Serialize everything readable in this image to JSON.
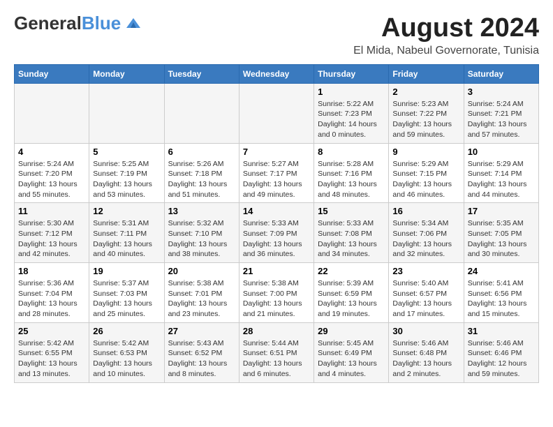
{
  "header": {
    "logo_line1": "General",
    "logo_line2": "Blue",
    "month_year": "August 2024",
    "location": "El Mida, Nabeul Governorate, Tunisia"
  },
  "weekdays": [
    "Sunday",
    "Monday",
    "Tuesday",
    "Wednesday",
    "Thursday",
    "Friday",
    "Saturday"
  ],
  "weeks": [
    [
      {
        "day": "",
        "info": ""
      },
      {
        "day": "",
        "info": ""
      },
      {
        "day": "",
        "info": ""
      },
      {
        "day": "",
        "info": ""
      },
      {
        "day": "1",
        "info": "Sunrise: 5:22 AM\nSunset: 7:23 PM\nDaylight: 14 hours\nand 0 minutes."
      },
      {
        "day": "2",
        "info": "Sunrise: 5:23 AM\nSunset: 7:22 PM\nDaylight: 13 hours\nand 59 minutes."
      },
      {
        "day": "3",
        "info": "Sunrise: 5:24 AM\nSunset: 7:21 PM\nDaylight: 13 hours\nand 57 minutes."
      }
    ],
    [
      {
        "day": "4",
        "info": "Sunrise: 5:24 AM\nSunset: 7:20 PM\nDaylight: 13 hours\nand 55 minutes."
      },
      {
        "day": "5",
        "info": "Sunrise: 5:25 AM\nSunset: 7:19 PM\nDaylight: 13 hours\nand 53 minutes."
      },
      {
        "day": "6",
        "info": "Sunrise: 5:26 AM\nSunset: 7:18 PM\nDaylight: 13 hours\nand 51 minutes."
      },
      {
        "day": "7",
        "info": "Sunrise: 5:27 AM\nSunset: 7:17 PM\nDaylight: 13 hours\nand 49 minutes."
      },
      {
        "day": "8",
        "info": "Sunrise: 5:28 AM\nSunset: 7:16 PM\nDaylight: 13 hours\nand 48 minutes."
      },
      {
        "day": "9",
        "info": "Sunrise: 5:29 AM\nSunset: 7:15 PM\nDaylight: 13 hours\nand 46 minutes."
      },
      {
        "day": "10",
        "info": "Sunrise: 5:29 AM\nSunset: 7:14 PM\nDaylight: 13 hours\nand 44 minutes."
      }
    ],
    [
      {
        "day": "11",
        "info": "Sunrise: 5:30 AM\nSunset: 7:12 PM\nDaylight: 13 hours\nand 42 minutes."
      },
      {
        "day": "12",
        "info": "Sunrise: 5:31 AM\nSunset: 7:11 PM\nDaylight: 13 hours\nand 40 minutes."
      },
      {
        "day": "13",
        "info": "Sunrise: 5:32 AM\nSunset: 7:10 PM\nDaylight: 13 hours\nand 38 minutes."
      },
      {
        "day": "14",
        "info": "Sunrise: 5:33 AM\nSunset: 7:09 PM\nDaylight: 13 hours\nand 36 minutes."
      },
      {
        "day": "15",
        "info": "Sunrise: 5:33 AM\nSunset: 7:08 PM\nDaylight: 13 hours\nand 34 minutes."
      },
      {
        "day": "16",
        "info": "Sunrise: 5:34 AM\nSunset: 7:06 PM\nDaylight: 13 hours\nand 32 minutes."
      },
      {
        "day": "17",
        "info": "Sunrise: 5:35 AM\nSunset: 7:05 PM\nDaylight: 13 hours\nand 30 minutes."
      }
    ],
    [
      {
        "day": "18",
        "info": "Sunrise: 5:36 AM\nSunset: 7:04 PM\nDaylight: 13 hours\nand 28 minutes."
      },
      {
        "day": "19",
        "info": "Sunrise: 5:37 AM\nSunset: 7:03 PM\nDaylight: 13 hours\nand 25 minutes."
      },
      {
        "day": "20",
        "info": "Sunrise: 5:38 AM\nSunset: 7:01 PM\nDaylight: 13 hours\nand 23 minutes."
      },
      {
        "day": "21",
        "info": "Sunrise: 5:38 AM\nSunset: 7:00 PM\nDaylight: 13 hours\nand 21 minutes."
      },
      {
        "day": "22",
        "info": "Sunrise: 5:39 AM\nSunset: 6:59 PM\nDaylight: 13 hours\nand 19 minutes."
      },
      {
        "day": "23",
        "info": "Sunrise: 5:40 AM\nSunset: 6:57 PM\nDaylight: 13 hours\nand 17 minutes."
      },
      {
        "day": "24",
        "info": "Sunrise: 5:41 AM\nSunset: 6:56 PM\nDaylight: 13 hours\nand 15 minutes."
      }
    ],
    [
      {
        "day": "25",
        "info": "Sunrise: 5:42 AM\nSunset: 6:55 PM\nDaylight: 13 hours\nand 13 minutes."
      },
      {
        "day": "26",
        "info": "Sunrise: 5:42 AM\nSunset: 6:53 PM\nDaylight: 13 hours\nand 10 minutes."
      },
      {
        "day": "27",
        "info": "Sunrise: 5:43 AM\nSunset: 6:52 PM\nDaylight: 13 hours\nand 8 minutes."
      },
      {
        "day": "28",
        "info": "Sunrise: 5:44 AM\nSunset: 6:51 PM\nDaylight: 13 hours\nand 6 minutes."
      },
      {
        "day": "29",
        "info": "Sunrise: 5:45 AM\nSunset: 6:49 PM\nDaylight: 13 hours\nand 4 minutes."
      },
      {
        "day": "30",
        "info": "Sunrise: 5:46 AM\nSunset: 6:48 PM\nDaylight: 13 hours\nand 2 minutes."
      },
      {
        "day": "31",
        "info": "Sunrise: 5:46 AM\nSunset: 6:46 PM\nDaylight: 12 hours\nand 59 minutes."
      }
    ]
  ]
}
